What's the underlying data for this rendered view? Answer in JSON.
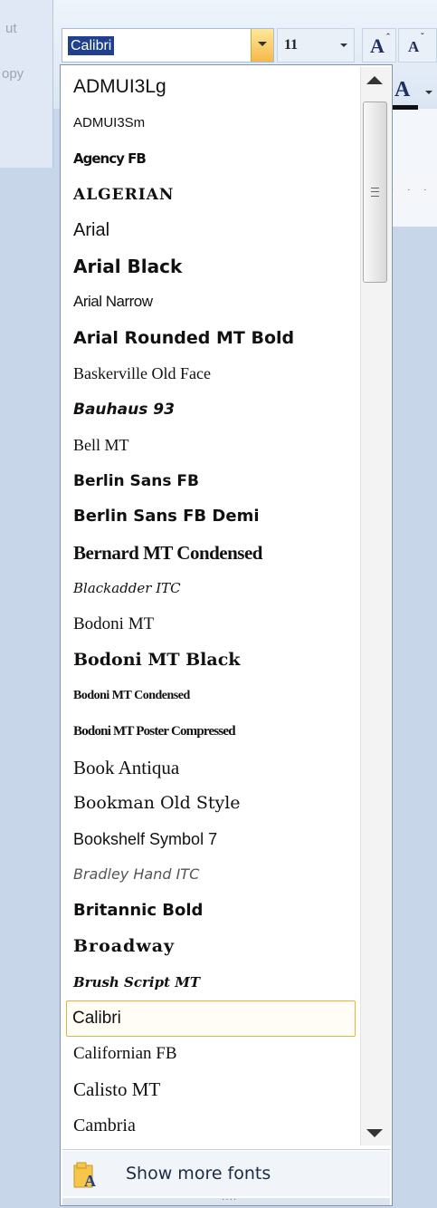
{
  "left_panel": {
    "cut_label": "ut",
    "copy_label": "opy"
  },
  "font_combo": {
    "value": "Calibri"
  },
  "size_combo": {
    "value": "11"
  },
  "grow_font_label": "A",
  "shrink_font_label": "A",
  "font_color_label": "A",
  "ruler_text": "· · ·",
  "fonts": [
    {
      "name": "ADMUI3Lg"
    },
    {
      "name": "ADMUI3Sm"
    },
    {
      "name": "Agency FB"
    },
    {
      "name": "ALGERIAN"
    },
    {
      "name": "Arial"
    },
    {
      "name": "Arial Black"
    },
    {
      "name": "Arial Narrow"
    },
    {
      "name": "Arial Rounded MT Bold"
    },
    {
      "name": "Baskerville Old Face"
    },
    {
      "name": "Bauhaus 93"
    },
    {
      "name": "Bell MT"
    },
    {
      "name": "Berlin Sans FB"
    },
    {
      "name": "Berlin Sans FB Demi"
    },
    {
      "name": "Bernard MT Condensed"
    },
    {
      "name": "Blackadder ITC"
    },
    {
      "name": "Bodoni MT"
    },
    {
      "name": "Bodoni MT Black"
    },
    {
      "name": "Bodoni MT Condensed"
    },
    {
      "name": "Bodoni MT Poster Compressed"
    },
    {
      "name": "Book Antiqua"
    },
    {
      "name": "Bookman Old Style"
    },
    {
      "name": "Bookshelf Symbol 7"
    },
    {
      "name": "Bradley Hand ITC"
    },
    {
      "name": "Britannic Bold"
    },
    {
      "name": "Broadway"
    },
    {
      "name": "Brush Script MT"
    },
    {
      "name": "Calibri"
    },
    {
      "name": "Californian FB"
    },
    {
      "name": "Calisto MT"
    },
    {
      "name": "Cambria"
    }
  ],
  "selected_font": "Calibri",
  "footer": {
    "show_more_label": "Show more fonts",
    "grip": "····"
  },
  "colors": {
    "selection_highlight": "#1f3f8f",
    "hover_border": "#e6b33a",
    "dropdown_button": "#f6b94a"
  }
}
